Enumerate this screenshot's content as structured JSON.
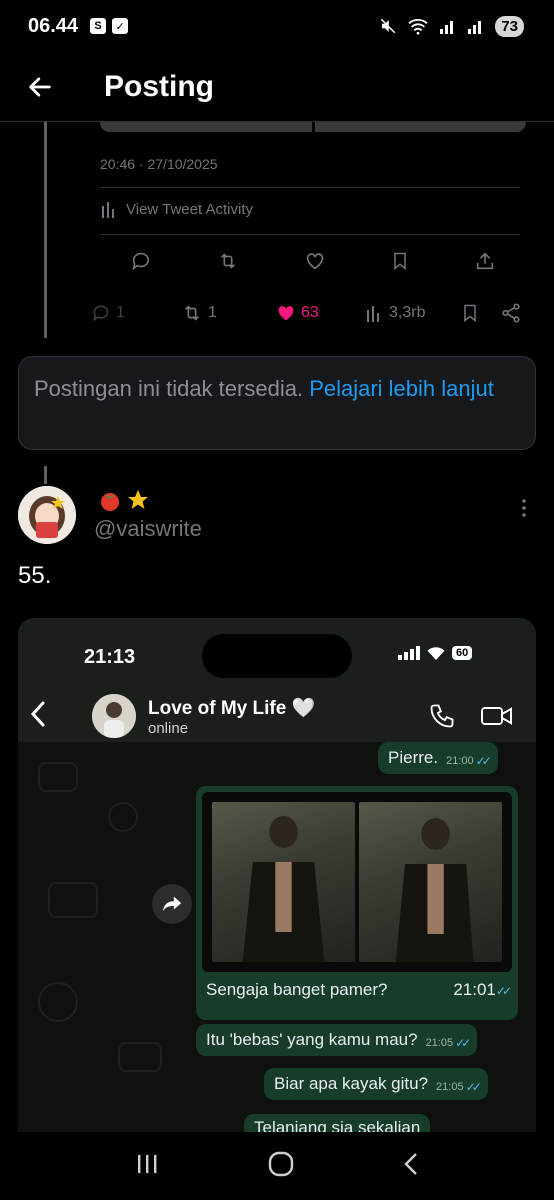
{
  "status_bar": {
    "time": "06.44",
    "icon_s": "S",
    "battery": "73"
  },
  "header": {
    "title": "Posting"
  },
  "quoted_tweet": {
    "timestamp": "20:46 · 27/10/2025",
    "activity_label": "View Tweet Activity"
  },
  "post_stats": {
    "replies": "1",
    "retweets": "1",
    "likes": "63",
    "views": "3,3rb",
    "like_color": "#f91880"
  },
  "unavailable_card": {
    "text": "Postingan ini tidak tersedia.",
    "link": "Pelajari lebih lanjut"
  },
  "reply": {
    "display_name_emojis": "🍅⭐",
    "handle": "@vaiswrite",
    "text": "55."
  },
  "chat_screenshot": {
    "ios_time": "21:13",
    "ios_battery": "60",
    "contact_name": "Love of My Life",
    "contact_status": "online",
    "messages": [
      {
        "text": "Pierre.",
        "time": "21:00"
      },
      {
        "text": "Sengaja banget pamer?",
        "time": "21:01"
      },
      {
        "text": "Itu 'bebas' yang kamu mau?",
        "time": "21:05"
      },
      {
        "text": "Biar apa kayak gitu?",
        "time": "21:05"
      },
      {
        "text": "Telanjang sja sekalian",
        "time": ""
      }
    ],
    "bubble_color": "#173d2a",
    "tick_color": "#53bdeb"
  },
  "accent": "#1d9bf0"
}
